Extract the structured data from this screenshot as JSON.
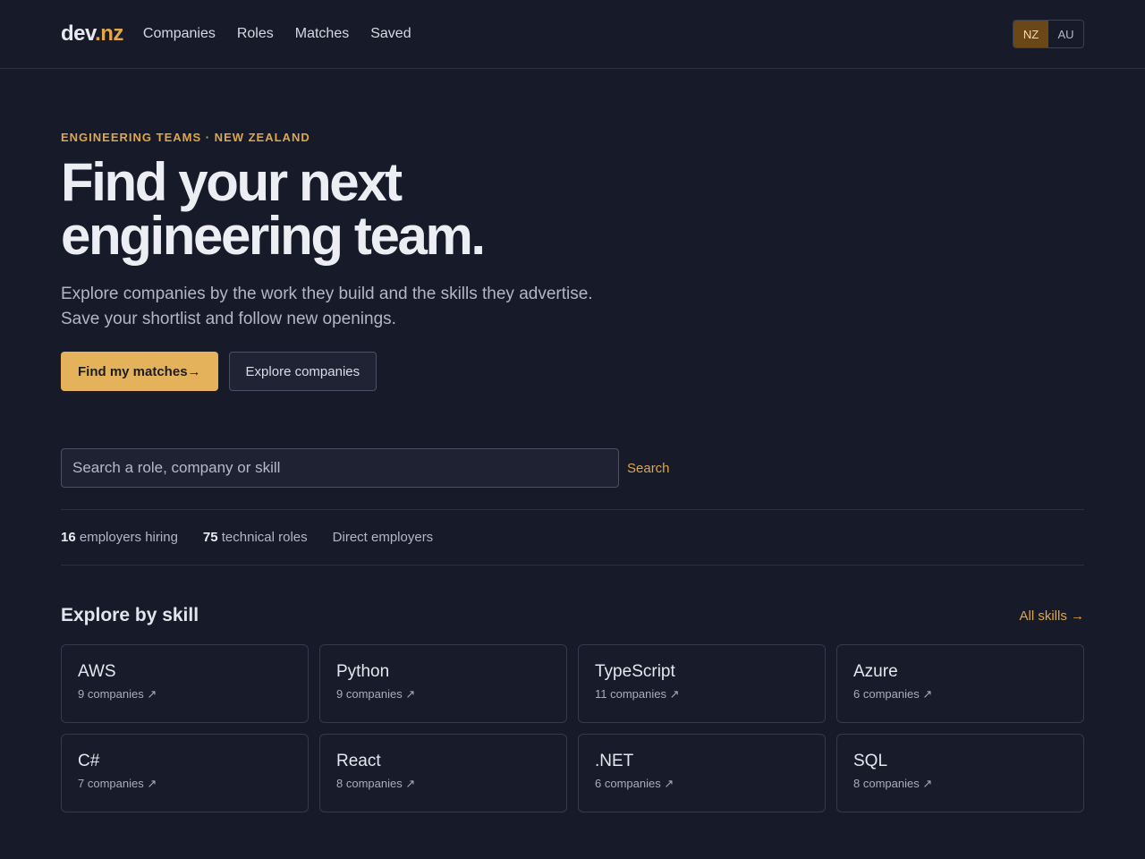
{
  "header": {
    "logo_dev": "dev",
    "logo_nz": ".nz",
    "nav": [
      "Companies",
      "Roles",
      "Matches",
      "Saved"
    ],
    "regions": [
      {
        "label": "NZ",
        "active": true
      },
      {
        "label": "AU",
        "active": false
      }
    ]
  },
  "hero": {
    "eyebrow": "ENGINEERING TEAMS · NEW ZEALAND",
    "title_line1": "Find your next",
    "title_line2": "engineering team.",
    "sub_line1": "Explore companies by the work they build and the skills they advertise.",
    "sub_line2": "Save your shortlist and follow new openings.",
    "primary_cta": "Find my matches→",
    "secondary_cta": "Explore companies"
  },
  "search": {
    "placeholder": "Search a role, company or skill",
    "value": "",
    "button": "Search"
  },
  "stats": {
    "employers_count": "16",
    "employers_label": "employers hiring",
    "roles_count": "75",
    "roles_label": "technical roles",
    "direct": "Direct employers"
  },
  "skills": {
    "title": "Explore by skill",
    "all_link": "All skills →",
    "items": [
      {
        "name": "AWS",
        "count": "9 companies ↗"
      },
      {
        "name": "Python",
        "count": "9 companies ↗"
      },
      {
        "name": "TypeScript",
        "count": "11 companies ↗"
      },
      {
        "name": "Azure",
        "count": "6 companies ↗"
      },
      {
        "name": "C#",
        "count": "7 companies ↗"
      },
      {
        "name": "React",
        "count": "8 companies ↗"
      },
      {
        "name": ".NET",
        "count": "6 companies ↗"
      },
      {
        "name": "SQL",
        "count": "8 companies ↗"
      }
    ]
  }
}
